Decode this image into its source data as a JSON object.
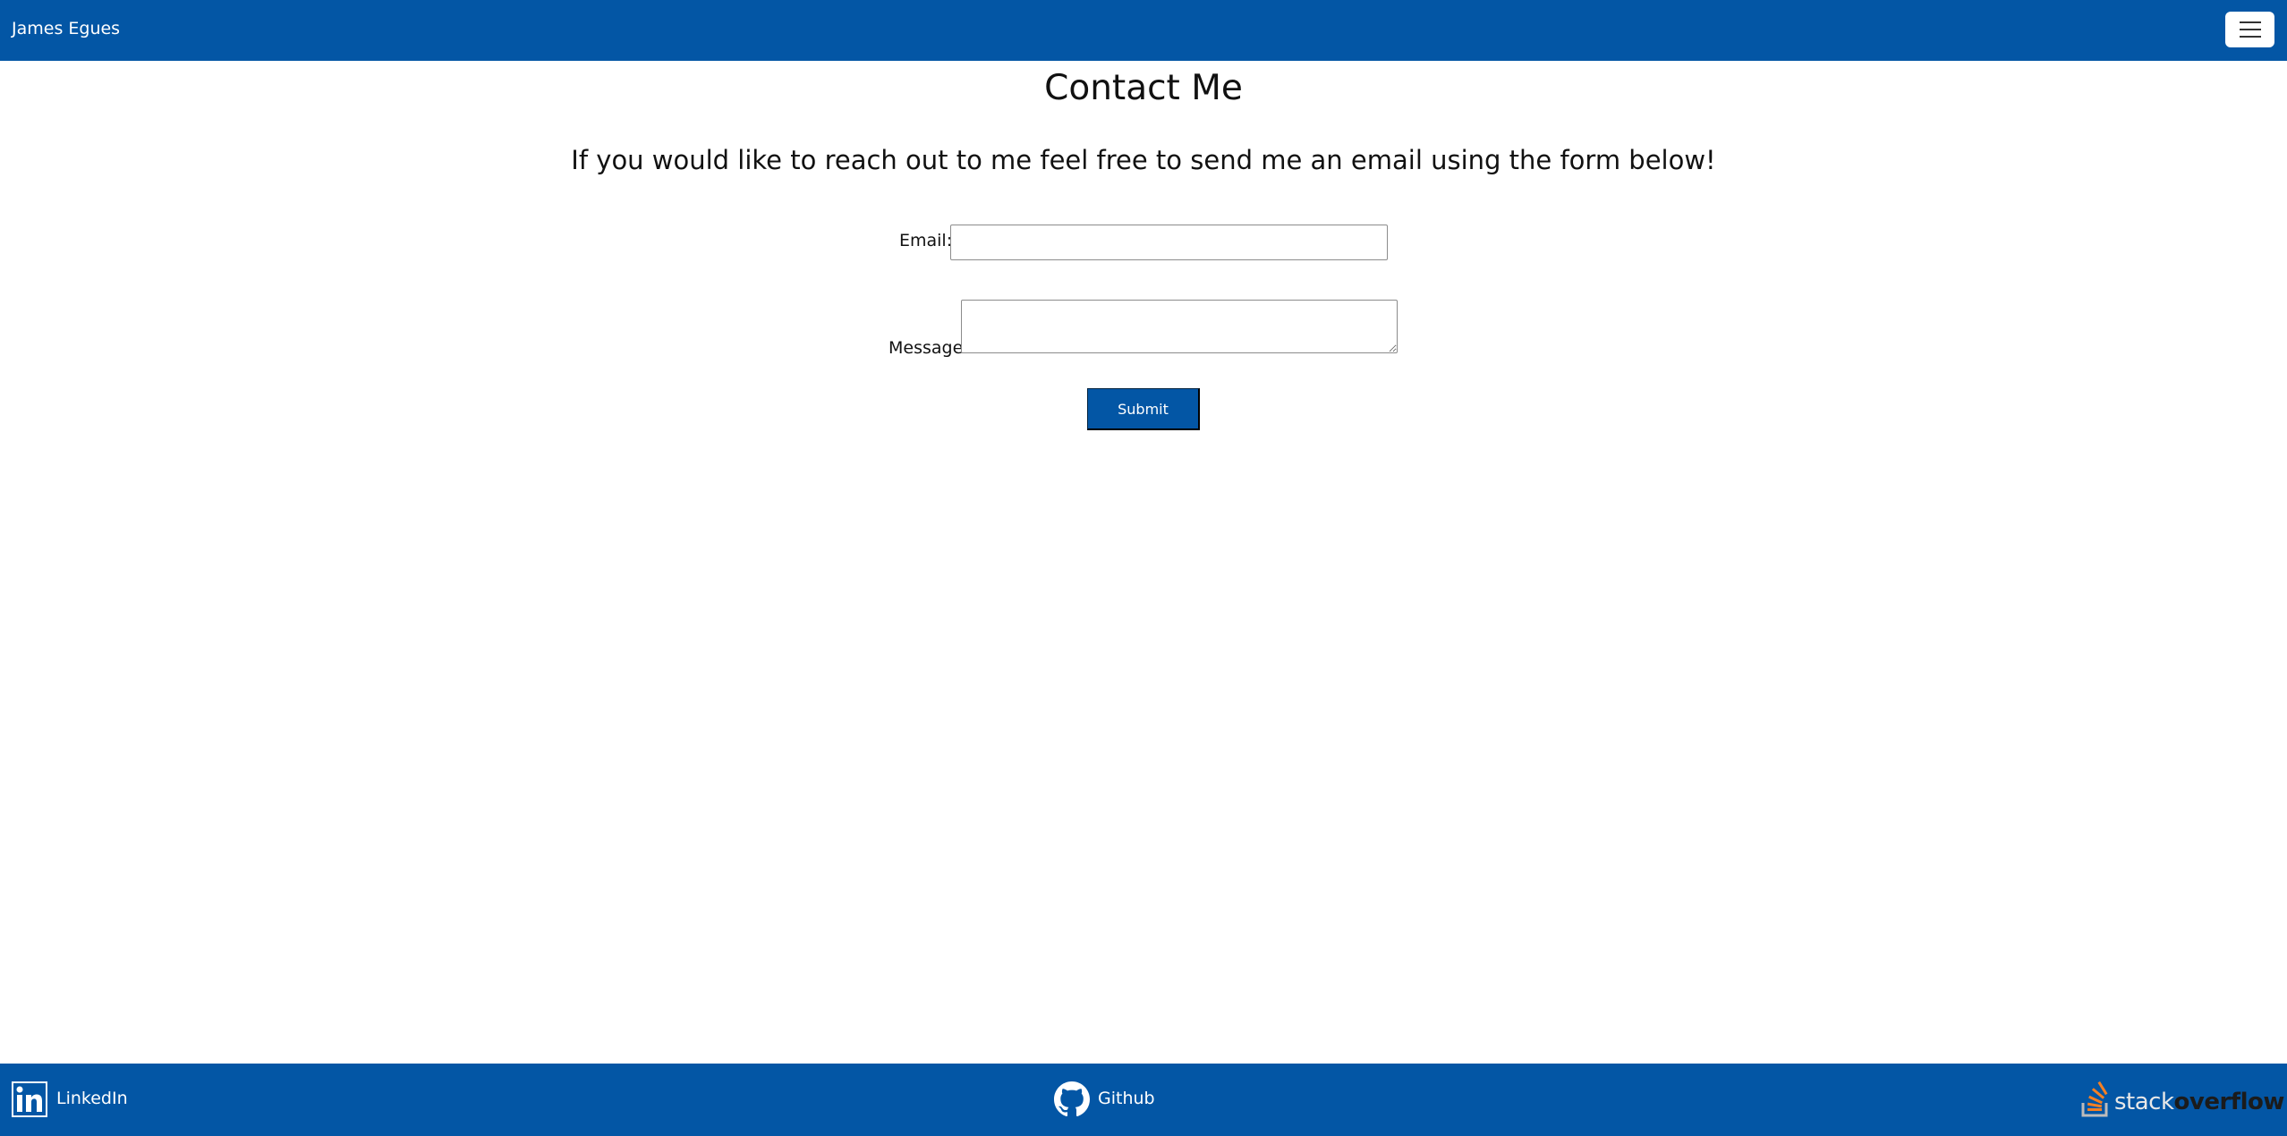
{
  "navbar": {
    "brand": "James Egues",
    "toggle_icon": "hamburger-menu-icon"
  },
  "main": {
    "title": "Contact Me",
    "intro": "If you would like to reach out to me feel free to send me an email using the form below!",
    "form": {
      "email_label": "Email:",
      "email_value": "",
      "message_label": "Message:",
      "message_value": "",
      "submit_label": "Submit"
    }
  },
  "footer": {
    "linkedin": {
      "label": "LinkedIn",
      "icon": "linkedin-icon"
    },
    "github": {
      "label": "Github",
      "icon": "github-icon"
    },
    "stackoverflow": {
      "logo_light": "stack",
      "logo_bold": "overflow",
      "icon": "stackoverflow-icon"
    }
  },
  "colors": {
    "primary": "#0356a5",
    "stackoverflow_orange": "#f48024"
  }
}
